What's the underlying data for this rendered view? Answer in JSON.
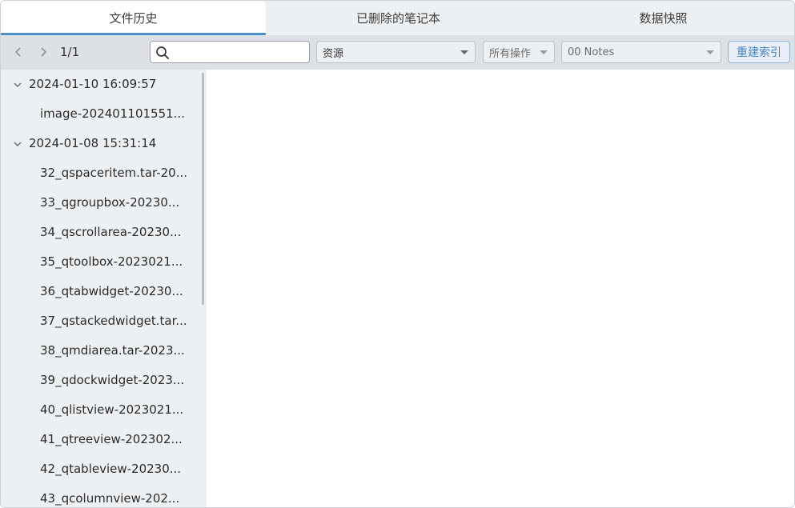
{
  "tabs": [
    {
      "label": "文件历史",
      "active": true
    },
    {
      "label": "已删除的笔记本",
      "active": false
    },
    {
      "label": "数据快照",
      "active": false
    }
  ],
  "toolbar": {
    "prev_icon": "chevron-left-icon",
    "next_icon": "chevron-right-icon",
    "page": "1/1",
    "search_value": "",
    "search_icon": "search-icon",
    "type_select": "资源",
    "op_select": "所有操作",
    "notebook_select": "00 Notes",
    "rebuild_label": "重建索引"
  },
  "sidebar": {
    "groups": [
      {
        "date": "2024-01-10 16:09:57",
        "items": [
          "image-202401101551..."
        ]
      },
      {
        "date": "2024-01-08 15:31:14",
        "items": [
          "32_qspaceritem.tar-20...",
          "33_qgroupbox-20230...",
          "34_qscrollarea-20230...",
          "35_qtoolbox-2023021...",
          "36_qtabwidget-20230...",
          "37_qstackedwidget.tar...",
          "38_qmdiarea.tar-2023...",
          "39_qdockwidget-2023...",
          "40_qlistview-2023021...",
          "41_qtreeview-202302...",
          "42_qtableview-20230...",
          "43_qcolumnview-202..."
        ]
      }
    ]
  },
  "colors": {
    "accent": "#4a90c7",
    "sidebar_bg": "#edf0f3",
    "toolbar_bg": "#dde1e5"
  }
}
